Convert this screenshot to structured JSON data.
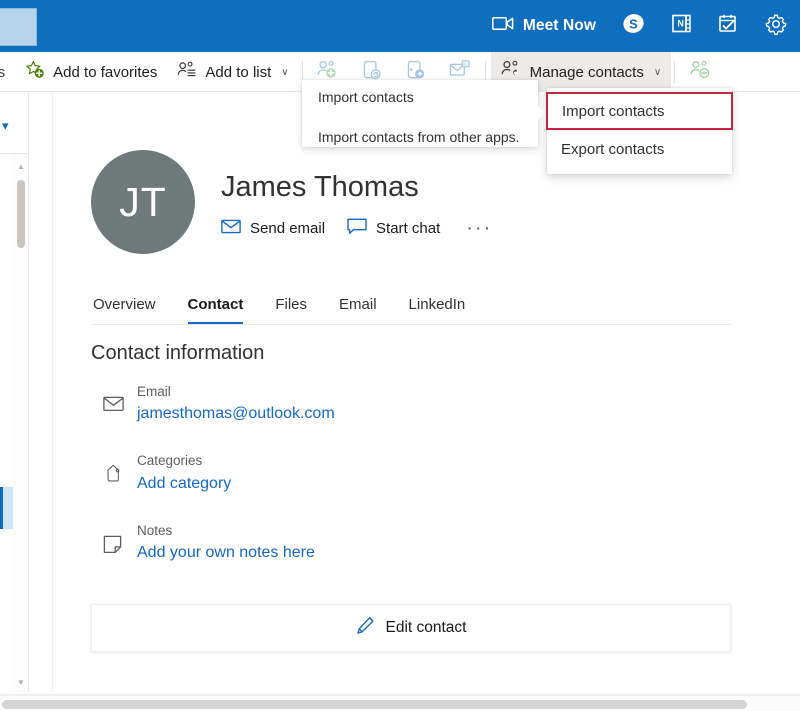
{
  "topbar": {
    "meet_now": {
      "label": "Meet Now",
      "icon": "video-camera-icon"
    },
    "icons": [
      {
        "name": "skype-icon",
        "label": "S"
      },
      {
        "name": "onenote-icon",
        "label": ""
      },
      {
        "name": "tasks-icon",
        "label": ""
      },
      {
        "name": "settings-gear-icon",
        "label": ""
      }
    ]
  },
  "commandbar": {
    "truncated_item": "cts",
    "add_to_favorites": {
      "label": "Add to favorites",
      "icon": "star-add-icon"
    },
    "add_to_list": {
      "label": "Add to list",
      "icon": "person-list-icon",
      "chevron": "∨"
    },
    "disabled_icons": [
      {
        "name": "add-person-icon"
      },
      {
        "name": "share-contact-icon"
      },
      {
        "name": "forward-contact-icon"
      },
      {
        "name": "mail-contact-icon"
      }
    ],
    "manage_contacts": {
      "label": "Manage contacts",
      "icon": "manage-contacts-icon",
      "chevron": "∨"
    },
    "trailing_icon": {
      "name": "remove-person-icon"
    }
  },
  "callout": {
    "items": [
      "Import contacts",
      "Import contacts from other apps."
    ]
  },
  "manage_menu": {
    "items": [
      {
        "label": "Import contacts",
        "highlighted": true
      },
      {
        "label": "Export contacts",
        "highlighted": false
      }
    ],
    "highlight_color": "#c0283c"
  },
  "profile": {
    "initials": "JT",
    "avatar_color": "#6e7a79",
    "name": "James Thomas",
    "actions": [
      {
        "label": "Send email",
        "icon": "envelope-icon"
      },
      {
        "label": "Start chat",
        "icon": "chat-bubble-icon"
      }
    ],
    "more_glyph": "···"
  },
  "tabs": [
    {
      "label": "Overview",
      "active": false
    },
    {
      "label": "Contact",
      "active": true
    },
    {
      "label": "Files",
      "active": false
    },
    {
      "label": "Email",
      "active": false
    },
    {
      "label": "LinkedIn",
      "active": false
    }
  ],
  "contact_information": {
    "title": "Contact information",
    "rows": [
      {
        "icon": "envelope-icon",
        "label": "Email",
        "value": "jamesthomas@outlook.com"
      },
      {
        "icon": "tag-icon",
        "label": "Categories",
        "value": "Add category"
      },
      {
        "icon": "note-icon",
        "label": "Notes",
        "value": "Add your own notes here"
      }
    ]
  },
  "edit_contact": {
    "label": "Edit contact",
    "icon": "pencil-icon"
  },
  "colors": {
    "brand_blue": "#106ebe",
    "link_blue": "#1668c1",
    "tab_underline": "#1668c1",
    "highlight_red": "#c0283c",
    "selected_row": "#cfe4f7"
  }
}
